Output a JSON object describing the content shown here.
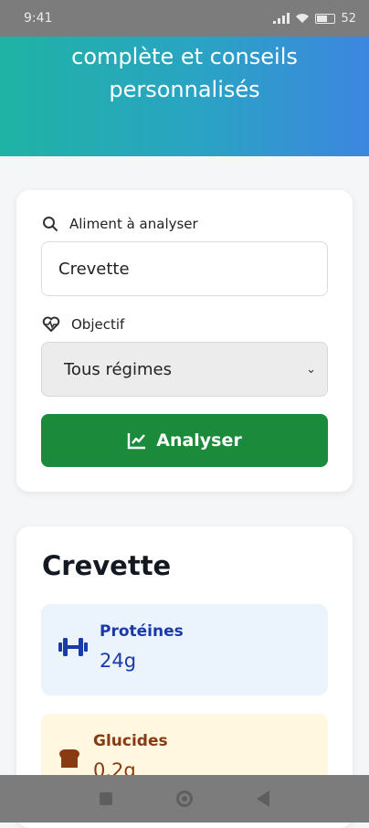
{
  "status_bar": {
    "time": "9:41",
    "battery": "52"
  },
  "header": {
    "line1": "complète et conseils",
    "line2": "personnalisés"
  },
  "form": {
    "food_label": "Aliment à analyser",
    "food_value": "Crevette",
    "goal_label": "Objectif",
    "goal_selected": "Tous régimes",
    "analyze_label": "Analyser"
  },
  "result": {
    "title": "Crevette",
    "nutrients": [
      {
        "name": "Protéines",
        "value": "24g",
        "icon": "dumbbell-icon",
        "color": "#1a3aa8"
      },
      {
        "name": "Glucides",
        "value": "0.2g",
        "icon": "bread-icon",
        "color": "#8a3a12"
      }
    ]
  },
  "colors": {
    "accent_green": "#1b8a3a",
    "gradient_start": "#1fb3a4",
    "gradient_end": "#3d86e0"
  }
}
